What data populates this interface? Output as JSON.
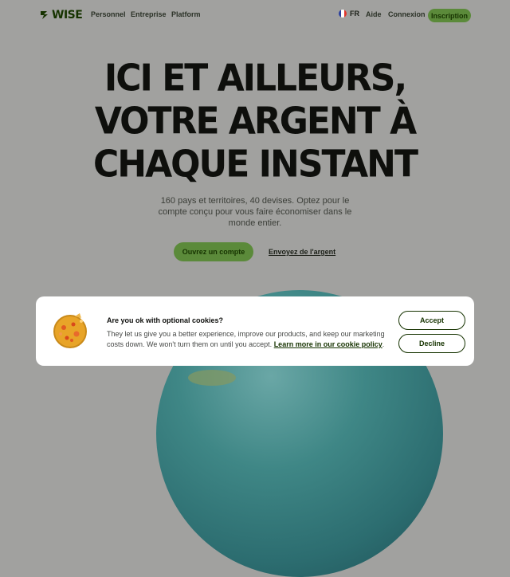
{
  "nav": {
    "logo_text": "WISE",
    "links": [
      "Personnel",
      "Entreprise",
      "Platform"
    ],
    "language": "FR",
    "help": "Aide",
    "login": "Connexion",
    "signup": "Inscription"
  },
  "hero": {
    "title_lines": [
      "ICI ET AILLEURS,",
      "VOTRE ARGENT À",
      "CHAQUE INSTANT"
    ],
    "subtitle": "160 pays et territoires, 40 devises. Optez pour le compte conçu pour vous faire économiser dans le monde entier.",
    "cta_primary": "Ouvrez un compte",
    "cta_secondary": "Envoyez de l'argent"
  },
  "cookie": {
    "title": "Are you ok with optional cookies?",
    "text": "They let us give you a better experience, improve our products, and keep our marketing costs down. We won't turn them on until you accept.",
    "link": "Learn more in our cookie policy",
    "link_suffix": ".",
    "accept": "Accept",
    "decline": "Decline"
  },
  "colors": {
    "brand_green": "#9fe870",
    "forest_green": "#163300"
  },
  "icons": {
    "logo": "wise-flag-icon",
    "flag": "france-flag-icon",
    "cookie": "cookie-icon"
  }
}
